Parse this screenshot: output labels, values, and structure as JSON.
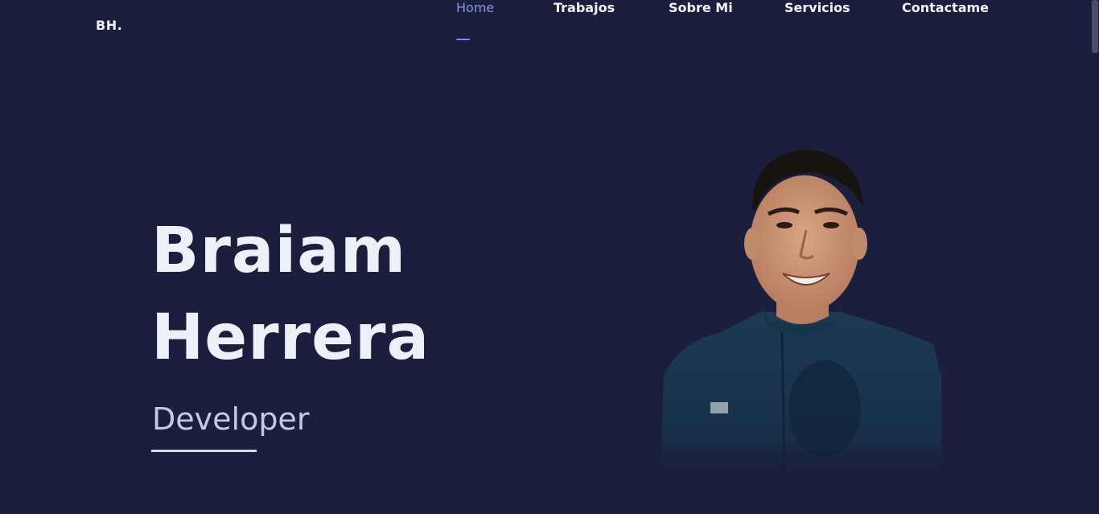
{
  "brand": {
    "logo": "BH."
  },
  "nav": {
    "items": [
      {
        "label": "Home",
        "active": true
      },
      {
        "label": "Trabajos",
        "active": false
      },
      {
        "label": "Sobre Mi",
        "active": false
      },
      {
        "label": "Servicios",
        "active": false
      },
      {
        "label": "Contactame",
        "active": false
      }
    ]
  },
  "hero": {
    "first_name": "Braiam",
    "last_name": "Herrera",
    "role": "Developer"
  },
  "colors": {
    "background": "#1b1e3c",
    "accent": "#7d89e2",
    "heading": "#eef0f8"
  }
}
